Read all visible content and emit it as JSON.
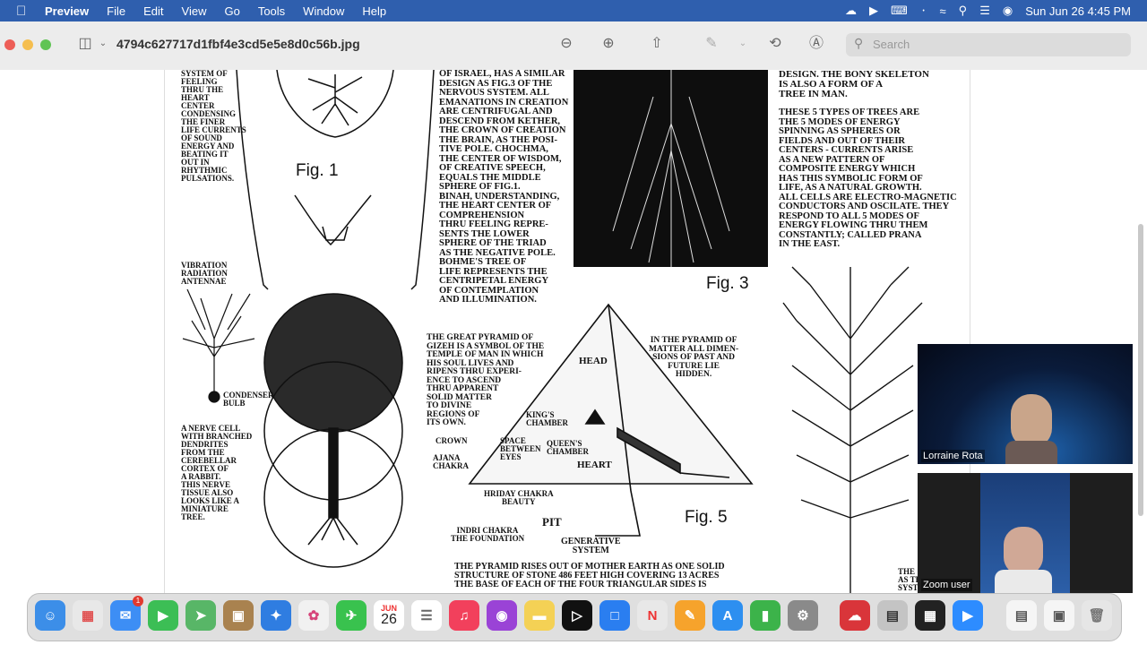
{
  "menubar": {
    "app": "Preview",
    "items": [
      "File",
      "Edit",
      "View",
      "Go",
      "Tools",
      "Window",
      "Help"
    ],
    "clock": "Sun Jun 26  4:45 PM"
  },
  "window": {
    "title": "4794c627717d1fbf4e3cd5e5e8d0c56b.jpg",
    "search_placeholder": "Search"
  },
  "document": {
    "col1_top": "SYSTEM OF\nFEELING\nTHRU THE\nHEART\nCENTER\nCONDENSING\nTHE FINER\nLIFE CURRENTS\nOF SOUND\nENERGY AND\nBEATING IT\nOUT IN\nRHYTHMIC\nPULSATIONS.",
    "fig1": "Fig. 1",
    "vibration": "VIBRATION\nRADIATION\nANTENNAE",
    "condenser": "CONDENSER\nBULB",
    "nerve": "A NERVE CELL\nWITH BRANCHED\nDENDRITES\nFROM THE\nCEREBELLAR\nCORTEX OF\nA RABBIT.\nTHIS NERVE\nTISSUE ALSO\nLOOKS LIKE A\nMINIATURE\nTREE.",
    "col2": "OF ISRAEL, HAS A SIMILAR\nDESIGN AS FIG.3 OF THE\nNERVOUS SYSTEM. ALL\nEMANATIONS IN CREATION\nARE CENTRIFUGAL AND\nDESCEND FROM KETHER,\nTHE CROWN OF CREATION\nTHE BRAIN, AS THE POSI-\nTIVE POLE. CHOCHMA,\nTHE CENTER OF WISDOM,\nOF CREATIVE SPEECH,\nEQUALS THE MIDDLE\nSPHERE OF FIG.1.\nBINAH, UNDERSTANDING,\nTHE HEART CENTER OF\nCOMPREHENSION\nTHRU FEELING REPRE-\nSENTS THE LOWER\nSPHERE OF THE TRIAD\nAS THE NEGATIVE POLE.\nBOHME'S TREE OF\nLIFE REPRESENTS THE\nCENTRIPETAL ENERGY\nOF CONTEMPLATION\nAND ILLUMINATION.",
    "fig3": "Fig. 3",
    "col4_top": "DESIGN. THE BONY SKELETON\nIS ALSO A FORM OF A\nTREE IN MAN.",
    "col4": "THESE 5 TYPES OF TREES ARE\nTHE 5 MODES OF ENERGY\nSPINNING AS SPHERES OR\nFIELDS AND OUT OF THEIR\nCENTERS - CURRENTS ARISE\nAS A NEW PATTERN OF\nCOMPOSITE ENERGY WHICH\nHAS THIS SYMBOLIC FORM OF\nLIFE, AS A NATURAL GROWTH.\nALL CELLS ARE ELECTRO-MAGNETIC\nCONDUCTORS AND OSCILATE. THEY\nRESPOND TO ALL 5 MODES OF\nENERGY FLOWING THRU THEM\nCONSTANTLY; CALLED PRANA\nIN THE EAST.",
    "gizeh": "THE GREAT PYRAMID OF\nGIZEH IS A SYMBOL OF THE\nTEMPLE OF MAN IN WHICH\nHIS SOUL LIVES AND\nRIPENS THRU EXPERI-\nENCE TO ASCEND\nTHRU APPARENT\nSOLID MATTER\nTO DIVINE\nREGIONS OF\nITS OWN.",
    "in_pyramid": "IN THE PYRAMID OF\nMATTER ALL DIMEN-\nSIONS OF PAST AND\nFUTURE LIE\nHIDDEN.",
    "head": "HEAD",
    "kings": "KING'S\nCHAMBER",
    "crown": "CROWN",
    "space": "SPACE\nBETWEEN\nEYES",
    "queens": "QUEEN'S\nCHAMBER",
    "heart": "HEART",
    "ajana": "AJANA\nCHAKRA",
    "hriday": "HRIDAY CHAKRA\nBEAUTY",
    "pit": "PIT",
    "indri": "INDRI CHAKRA\nTHE FOUNDATION",
    "generative": "GENERATIVE\nSYSTEM",
    "fig5": "Fig. 5",
    "bottom": "THE PYRAMID RISES OUT OF MOTHER EARTH AS ONE SOLID\nSTRUCTURE OF STONE 486 FEET HIGH COVERING 13 ACRES\nTHE BASE OF EACH OF THE FOUR TRIANGULAR SIDES IS",
    "right_edge": "THE\nAS TH\nSYST"
  },
  "zoom": {
    "participant1": "Lorraine Rota",
    "participant2": "Zoom user"
  },
  "dock": {
    "calendar_month": "JUN",
    "calendar_day": "26",
    "mail_badge": "1"
  }
}
